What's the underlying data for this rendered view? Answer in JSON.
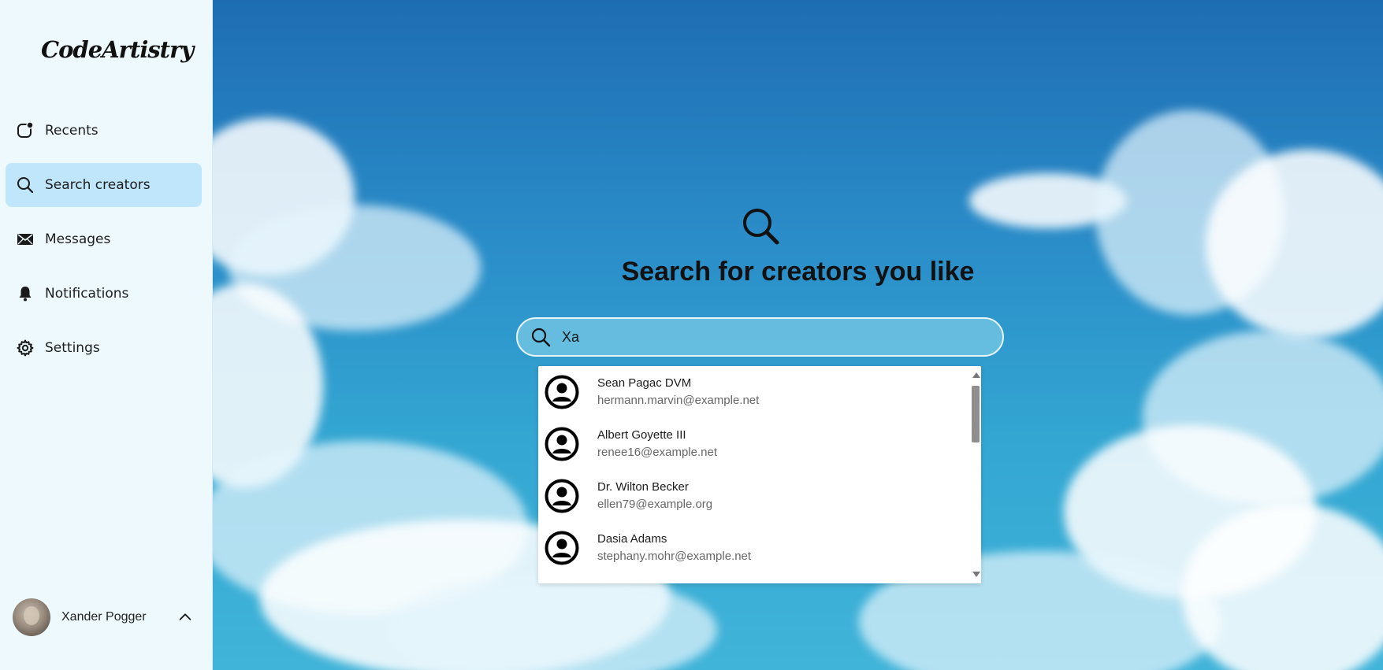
{
  "sidebar": {
    "logo": "CodeArtistry",
    "items": [
      {
        "label": "Recents",
        "icon": "recents-icon",
        "active": false
      },
      {
        "label": "Search creators",
        "icon": "search-icon",
        "active": true
      },
      {
        "label": "Messages",
        "icon": "envelope-icon",
        "active": false
      },
      {
        "label": "Notifications",
        "icon": "bell-icon",
        "active": false
      },
      {
        "label": "Settings",
        "icon": "gear-icon",
        "active": false
      }
    ],
    "user": {
      "name": "Xander Pogger",
      "chevron": "chevron-up-icon"
    }
  },
  "main": {
    "title": "Search for creators you like",
    "search": {
      "value": "Xa",
      "placeholder": ""
    },
    "results": [
      {
        "name": "Sean Pagac DVM",
        "email": "hermann.marvin@example.net"
      },
      {
        "name": "Albert Goyette III",
        "email": "renee16@example.net"
      },
      {
        "name": "Dr. Wilton Becker",
        "email": "ellen79@example.org"
      },
      {
        "name": "Dasia Adams",
        "email": "stephany.mohr@example.net"
      }
    ]
  },
  "colors": {
    "sidebar_bg": "#eef9fd",
    "active_item_bg": "#c0e6fb",
    "sky_top": "#1e6db3",
    "sky_bottom": "#41b4d9"
  }
}
